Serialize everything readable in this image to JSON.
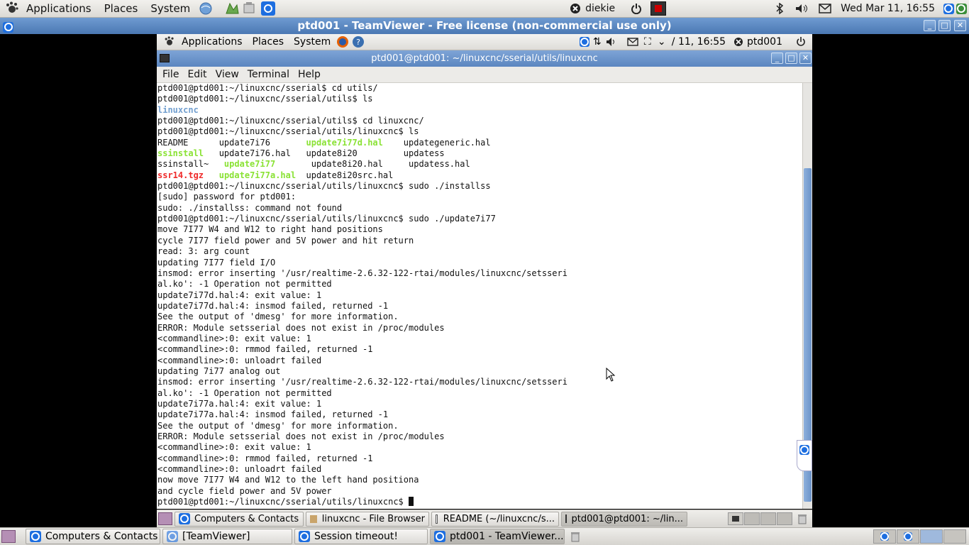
{
  "host_panel": {
    "menus": [
      "Applications",
      "Places",
      "System"
    ],
    "user": "diekie",
    "datetime": "Wed Mar 11, 16:55"
  },
  "teamviewer_title": "ptd001 - TeamViewer - Free license (non-commercial use only)",
  "remote_panel": {
    "menus": [
      "Applications",
      "Places",
      "System"
    ],
    "time_fragment": "/ 11, 16:55",
    "user": "ptd001"
  },
  "terminal": {
    "title": "ptd001@ptd001: ~/linuxcnc/sserial/utils/linuxcnc",
    "menu": [
      "File",
      "Edit",
      "View",
      "Terminal",
      "Help"
    ],
    "lines": [
      [
        {
          "t": "ptd001@ptd001:~/linuxcnc/sserial$ cd utils/"
        }
      ],
      [
        {
          "t": "ptd001@ptd001:~/linuxcnc/sserial/utils$ ls"
        }
      ],
      [
        {
          "t": "linuxcnc",
          "c": "dir"
        }
      ],
      [
        {
          "t": "ptd001@ptd001:~/linuxcnc/sserial/utils$ cd linuxcnc/"
        }
      ],
      [
        {
          "t": "ptd001@ptd001:~/linuxcnc/sserial/utils/linuxcnc$ ls"
        }
      ],
      [
        {
          "t": "README      update7i76       "
        },
        {
          "t": "update7i77d.hal",
          "c": "exe"
        },
        {
          "t": "    updategeneric.hal"
        }
      ],
      [
        {
          "t": "ssinstall",
          "c": "exe"
        },
        {
          "t": "   update7i76.hal   update8i20         updatess"
        }
      ],
      [
        {
          "t": "ssinstall~   "
        },
        {
          "t": "update7i77",
          "c": "exe"
        },
        {
          "t": "       update8i20.hal     updatess.hal"
        }
      ],
      [
        {
          "t": "ssr14.tgz",
          "c": "arc"
        },
        {
          "t": "   "
        },
        {
          "t": "update7i77a.hal",
          "c": "exe"
        },
        {
          "t": "  update8i20src.hal"
        }
      ],
      [
        {
          "t": "ptd001@ptd001:~/linuxcnc/sserial/utils/linuxcnc$ sudo ./installss"
        }
      ],
      [
        {
          "t": "[sudo] password for ptd001:"
        }
      ],
      [
        {
          "t": "sudo: ./installss: command not found"
        }
      ],
      [
        {
          "t": "ptd001@ptd001:~/linuxcnc/sserial/utils/linuxcnc$ sudo ./update7i77"
        }
      ],
      [
        {
          "t": "move 7I77 W4 and W12 to right hand positions"
        }
      ],
      [
        {
          "t": "cycle 7I77 field power and 5V power and hit return"
        }
      ],
      [
        {
          "t": "read: 3: arg count"
        }
      ],
      [
        {
          "t": "updating 7I77 field I/O"
        }
      ],
      [
        {
          "t": "insmod: error inserting '/usr/realtime-2.6.32-122-rtai/modules/linuxcnc/setsseri"
        }
      ],
      [
        {
          "t": "al.ko': -1 Operation not permitted"
        }
      ],
      [
        {
          "t": "update7i77d.hal:4: exit value: 1"
        }
      ],
      [
        {
          "t": "update7i77d.hal:4: insmod failed, returned -1"
        }
      ],
      [
        {
          "t": "See the output of 'dmesg' for more information."
        }
      ],
      [
        {
          "t": "ERROR: Module setsserial does not exist in /proc/modules"
        }
      ],
      [
        {
          "t": "<commandline>:0: exit value: 1"
        }
      ],
      [
        {
          "t": "<commandline>:0: rmmod failed, returned -1"
        }
      ],
      [
        {
          "t": "<commandline>:0: unloadrt failed"
        }
      ],
      [
        {
          "t": "updating 7i77 analog out"
        }
      ],
      [
        {
          "t": "insmod: error inserting '/usr/realtime-2.6.32-122-rtai/modules/linuxcnc/setsseri"
        }
      ],
      [
        {
          "t": "al.ko': -1 Operation not permitted"
        }
      ],
      [
        {
          "t": "update7i77a.hal:4: exit value: 1"
        }
      ],
      [
        {
          "t": "update7i77a.hal:4: insmod failed, returned -1"
        }
      ],
      [
        {
          "t": "See the output of 'dmesg' for more information."
        }
      ],
      [
        {
          "t": "ERROR: Module setsserial does not exist in /proc/modules"
        }
      ],
      [
        {
          "t": "<commandline>:0: exit value: 1"
        }
      ],
      [
        {
          "t": "<commandline>:0: rmmod failed, returned -1"
        }
      ],
      [
        {
          "t": "<commandline>:0: unloadrt failed"
        }
      ],
      [
        {
          "t": "now move 7I77 W4 and W12 to the left hand positiona"
        }
      ],
      [
        {
          "t": "and cycle field power and 5V power"
        }
      ],
      [
        {
          "t": "ptd001@ptd001:~/linuxcnc/sserial/utils/linuxcnc$ "
        }
      ]
    ]
  },
  "remote_taskbar": [
    "Computers & Contacts",
    "linuxcnc - File Browser",
    "README (~/linuxcnc/s...",
    "ptd001@ptd001: ~/lin..."
  ],
  "host_taskbar": [
    "Computers & Contacts",
    "[TeamViewer]",
    "Session timeout!",
    "ptd001 - TeamViewer..."
  ],
  "colors": {
    "dir": "#729fcf",
    "exe": "#8ae234",
    "arc": "#ef2929",
    "title_blue": "#5b86c0"
  }
}
